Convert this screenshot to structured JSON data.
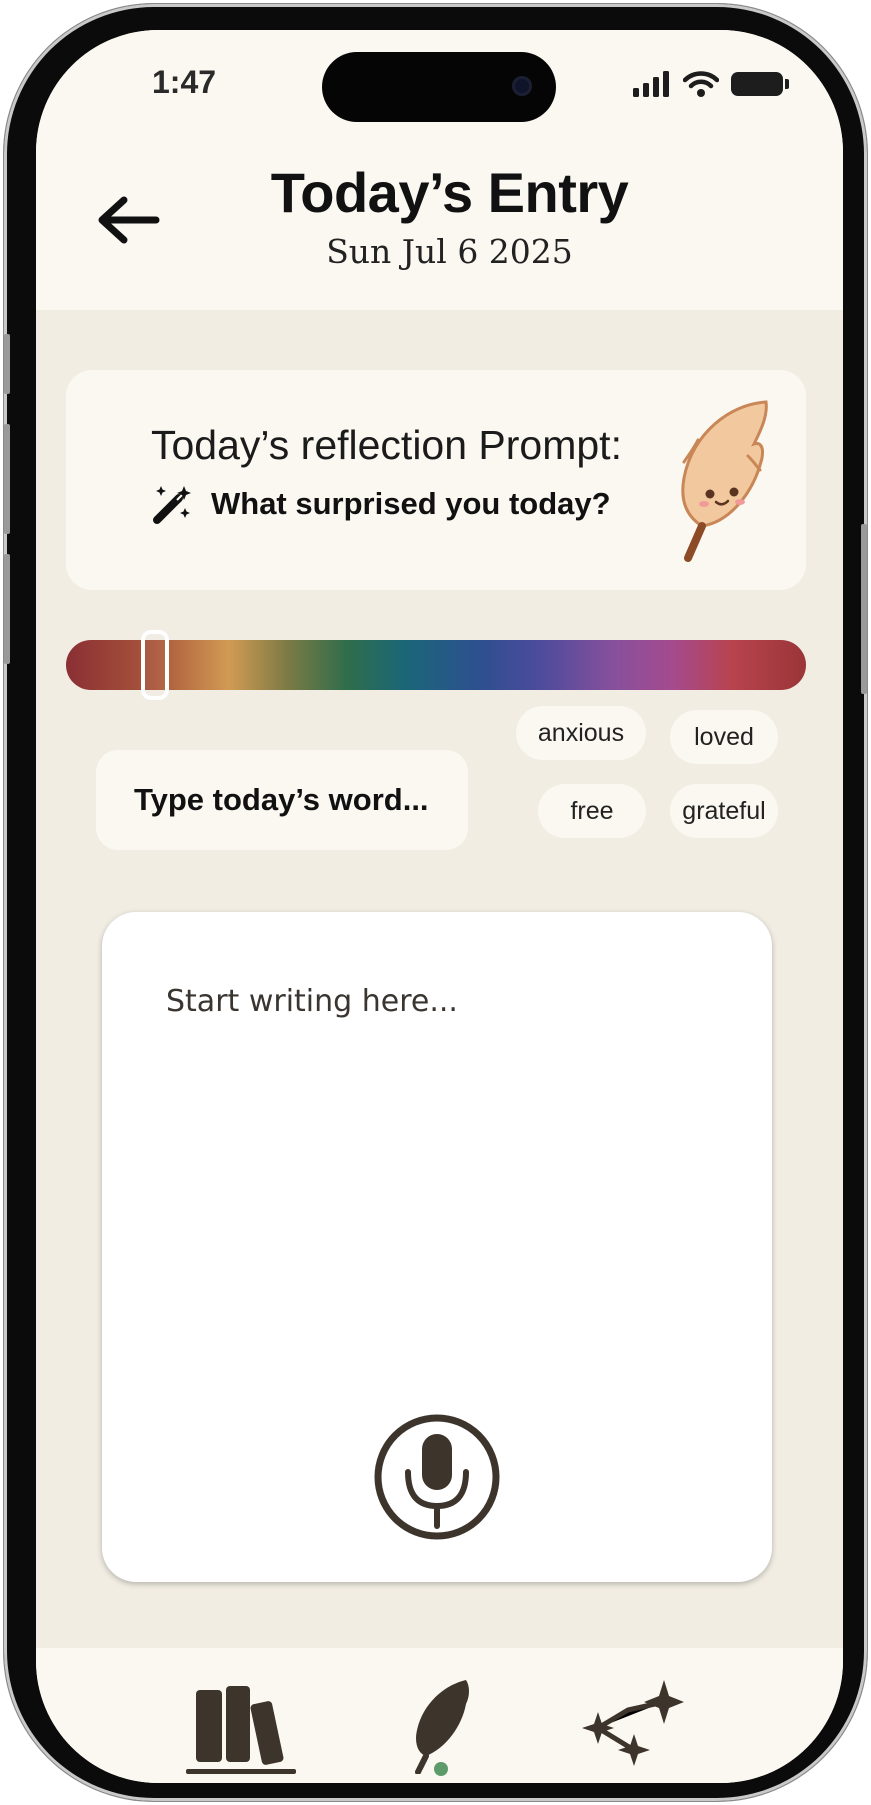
{
  "status_bar": {
    "time": "1:47"
  },
  "header": {
    "title": "Today’s Entry",
    "date": "Sun Jul 6 2025"
  },
  "prompt": {
    "label": "Today’s reflection Prompt:",
    "question": "What surprised you today?"
  },
  "mood_slider": {
    "value": 0.12
  },
  "word_input": {
    "placeholder": "Type today’s word..."
  },
  "word_chips": [
    "anxious",
    "loved",
    "free",
    "grateful"
  ],
  "writing": {
    "placeholder": "Start writing here..."
  },
  "tabs": [
    {
      "icon": "bookshelf-icon",
      "selected": true
    },
    {
      "icon": "quill-icon",
      "selected": false,
      "dot": true
    },
    {
      "icon": "constellation-icon",
      "selected": false
    }
  ],
  "colors": {
    "background": "#f1ede3",
    "card": "#fbf8f2",
    "ink": "#3d342c",
    "accent_dot": "#5e9b6a",
    "feather": "#f2c89f"
  }
}
